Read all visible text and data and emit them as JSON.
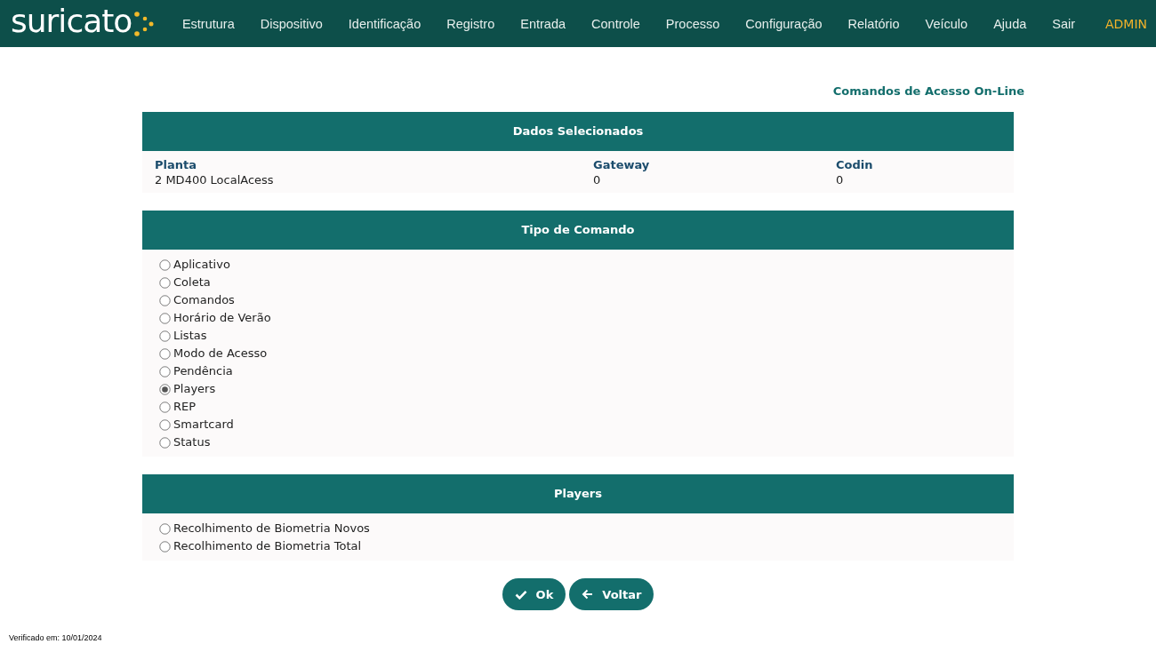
{
  "logo": {
    "text": "suricato"
  },
  "menu": [
    "Estrutura",
    "Dispositivo",
    "Identificação",
    "Registro",
    "Entrada",
    "Controle",
    "Processo",
    "Configuração",
    "Relatório",
    "Veículo",
    "Ajuda",
    "Sair"
  ],
  "user": "ADMIN",
  "page_title": "Comandos de Acesso On-Line",
  "selected_data": {
    "title": "Dados Selecionados",
    "fields": [
      {
        "label": "Planta",
        "value": "2 MD400 LocalAcess"
      },
      {
        "label": "Gateway",
        "value": "0"
      },
      {
        "label": "Codin",
        "value": "0"
      }
    ]
  },
  "command_type": {
    "title": "Tipo de Comando",
    "options": [
      {
        "label": "Aplicativo",
        "selected": false
      },
      {
        "label": "Coleta",
        "selected": false
      },
      {
        "label": "Comandos",
        "selected": false
      },
      {
        "label": "Horário de Verão",
        "selected": false
      },
      {
        "label": "Listas",
        "selected": false
      },
      {
        "label": "Modo de Acesso",
        "selected": false
      },
      {
        "label": "Pendência",
        "selected": false
      },
      {
        "label": "Players",
        "selected": true
      },
      {
        "label": "REP",
        "selected": false
      },
      {
        "label": "Smartcard",
        "selected": false
      },
      {
        "label": "Status",
        "selected": false
      }
    ]
  },
  "players": {
    "title": "Players",
    "options": [
      {
        "label": "Recolhimento de Biometria Novos",
        "selected": false
      },
      {
        "label": "Recolhimento de Biometria Total",
        "selected": false
      }
    ]
  },
  "buttons": [
    {
      "kind": "ok",
      "label": "Ok"
    },
    {
      "kind": "back",
      "label": "Voltar"
    }
  ],
  "footer": "Verificado em: 10/01/2024"
}
